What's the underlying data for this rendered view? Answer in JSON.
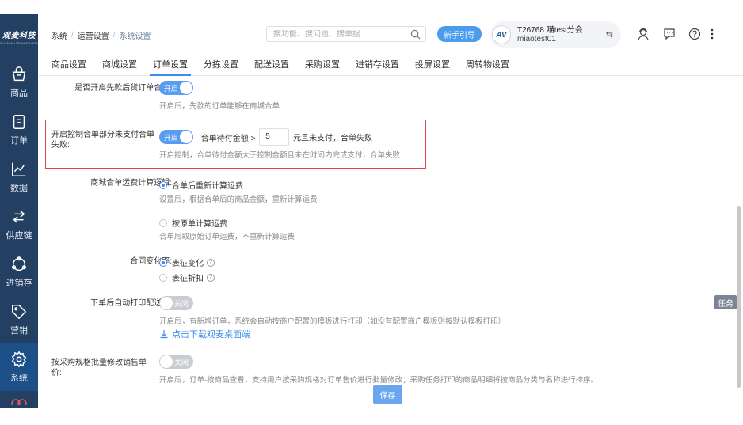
{
  "sidebar": {
    "logo": "观麦科技",
    "logo_sub": "GUANMAI TECHNOLOGY",
    "items": [
      {
        "label": "商品",
        "icon": "basket-icon"
      },
      {
        "label": "订单",
        "icon": "order-doc-icon"
      },
      {
        "label": "数据",
        "icon": "line-chart-icon"
      },
      {
        "label": "供应链",
        "icon": "exchange-arrows-icon"
      },
      {
        "label": "进销存",
        "icon": "cycle-icon"
      },
      {
        "label": "营销",
        "icon": "tag-icon"
      },
      {
        "label": "系统",
        "icon": "gear-icon",
        "active": true
      }
    ]
  },
  "header": {
    "breadcrumb": [
      "系统",
      "运营设置",
      "系统设置"
    ],
    "search_placeholder": "搜功能、搜问题、搜单据",
    "guide_label": "新手引导",
    "account_avatar": "AV",
    "account_shop": "T26768 喵test分会",
    "account_user": "miaotest01",
    "switch_symbol": "⇆"
  },
  "tabs": [
    "商品设置",
    "商城设置",
    "订单设置",
    "分拣设置",
    "配送设置",
    "采购设置",
    "进销存设置",
    "投屏设置",
    "周转物设置"
  ],
  "active_tab": 2,
  "settings": {
    "first_pay_merge": {
      "label": "是否开启先款后货订单合并:",
      "toggle": "开启",
      "hint": "开启后，先款的订单能够在商城合单"
    },
    "partial_unpaid_fail": {
      "label": "开启控制合单部分未支付合单失败:",
      "toggle": "开启",
      "prefix": "合单待付金额 >",
      "amount": "5",
      "suffix": "元且未支付，合单失败",
      "hint": "开启控制，合单待付金额大于控制金额且未在时间内完成支付，合单失败"
    },
    "freight_logic": {
      "label": "商城合单运费计算逻辑:",
      "option1": "合单后重新计算运费",
      "hint1": "设置后，根据合单后的商品金额，重新计算运费",
      "option2": "按原单计算运费",
      "hint2": "合单后取原始订单运费，不重新计算运费"
    },
    "contract_rate": {
      "label": "合同变化率:",
      "option1": "表征变化",
      "option2": "表征折扣",
      "qmark": "?"
    },
    "auto_print": {
      "label": "下单后自动打印配送单:",
      "toggle": "关闭",
      "hint": "开启后，有新增订单，系统会自动按商户配置的模板进行打印（如没有配置商户模板则按默认模板打印）",
      "download_link": "点击下载观麦桌面端"
    },
    "batch_price": {
      "label": "按采购规格批量修改销售单价:",
      "toggle": "关闭",
      "hint": "开启后，订单-按商品查看，支持用户按采购规格对订单售价进行批量修改；采购任务打印的商品明细将按商品分类与名称进行排序。"
    }
  },
  "footer": {
    "save_label": "保存"
  },
  "task_label": "任务",
  "colors": {
    "sidebar": "#233f61",
    "accent": "#3b8bea",
    "highlight_border": "#e0444a"
  }
}
